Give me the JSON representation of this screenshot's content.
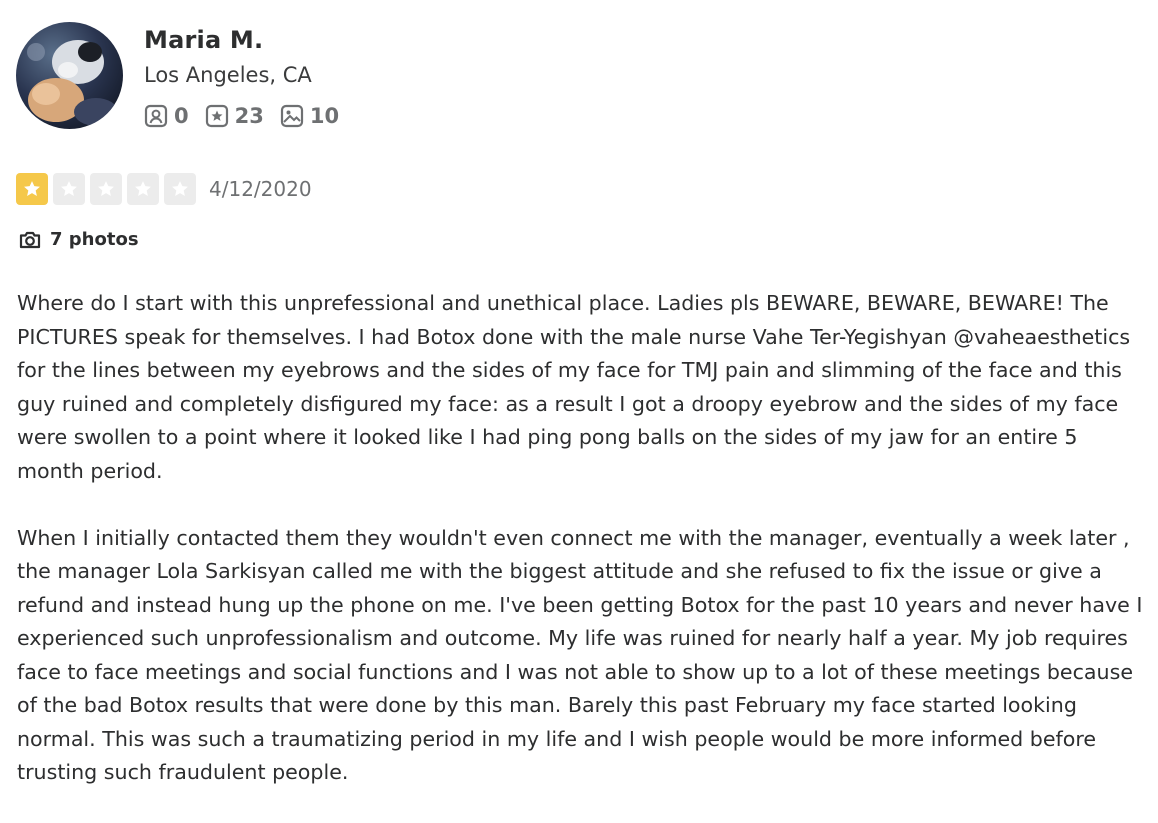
{
  "user": {
    "name": "Maria M.",
    "location": "Los Angeles, CA",
    "stats": {
      "friends": "0",
      "reviews": "23",
      "photos": "10"
    }
  },
  "review": {
    "rating": 1,
    "max_rating": 5,
    "date": "4/12/2020",
    "photos_label": "7 photos",
    "paragraphs": [
      "Where do I start with this unprefessional and unethical place. Ladies pls BEWARE, BEWARE, BEWARE! The PICTURES speak for themselves. I had Botox done with the male nurse Vahe Ter-Yegishyan @vaheaesthetics for the lines between my eyebrows and the sides of my face for TMJ pain and slimming of the face and this guy ruined and completely disfigured my face: as a result I got a droopy eyebrow and the sides of my face were swollen to a point where it looked like I had ping pong balls on the sides of my jaw for an entire 5 month period.",
      "When I initially contacted them they wouldn't even connect me with the manager, eventually a week later , the manager Lola Sarkisyan called me with the biggest attitude and she refused to fix the issue or give a refund and instead hung up the phone on me. I've been getting Botox for the past 10 years and never have I experienced such unprofessionalism and outcome. My life was ruined for nearly half a year. My job requires face to face meetings and social functions and I was not able to show up to a lot of these meetings because of the bad Botox results that were done by this man. Barely this past February my face started looking normal. This was such a traumatizing period in my life and I wish people would be more informed before trusting such fraudulent people."
    ]
  },
  "icons": {
    "avatar": "user-avatar-photo",
    "friends": "friends-icon",
    "reviews": "review-star-icon",
    "photos": "photo-icon",
    "camera": "camera-icon",
    "star": "star-icon"
  },
  "colors": {
    "star_filled": "#f5c84a",
    "star_empty": "#ececec",
    "text": "#2d2e2f",
    "muted": "#6e7072"
  }
}
